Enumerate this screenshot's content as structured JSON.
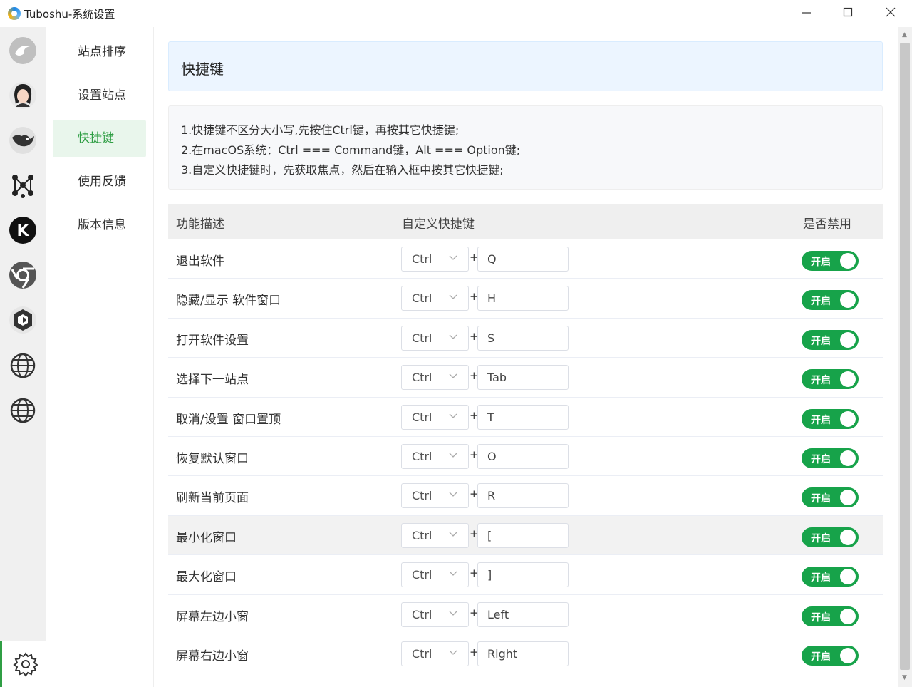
{
  "window": {
    "title": "Tuboshu-系统设置"
  },
  "colors": {
    "accent": "#17a34a",
    "active_menu_bg": "#e9f6ec",
    "header_bg": "#ecf5ff"
  },
  "site_icons": [
    "site-1-icon",
    "avatar-site-icon",
    "bird-site-icon",
    "network-site-icon",
    "k-site-icon",
    "chrome-site-icon",
    "cube-site-icon",
    "globe-site-icon",
    "globe-site-icon-2"
  ],
  "menu": {
    "items": [
      {
        "label": "站点排序"
      },
      {
        "label": "设置站点"
      },
      {
        "label": "快捷键"
      },
      {
        "label": "使用反馈"
      },
      {
        "label": "版本信息"
      }
    ],
    "active_index": 2
  },
  "page": {
    "title": "快捷键",
    "tips": [
      "1.快捷键不区分大小写,先按住Ctrl键，再按其它快捷键;",
      "2.在macOS系统：Ctrl === Command键，Alt === Option键;",
      "3.自定义快捷键时，先获取焦点，然后在输入框中按其它快捷键;"
    ]
  },
  "table": {
    "headers": {
      "desc": "功能描述",
      "shortcut": "自定义快捷键",
      "enabled": "是否禁用"
    },
    "plus": "+",
    "switch_label": "开启",
    "rows": [
      {
        "desc": "退出软件",
        "modifier": "Ctrl",
        "key": "Q",
        "enabled": true
      },
      {
        "desc": "隐藏/显示 软件窗口",
        "modifier": "Ctrl",
        "key": "H",
        "enabled": true
      },
      {
        "desc": "打开软件设置",
        "modifier": "Ctrl",
        "key": "S",
        "enabled": true
      },
      {
        "desc": "选择下一站点",
        "modifier": "Ctrl",
        "key": "Tab",
        "enabled": true
      },
      {
        "desc": "取消/设置 窗口置顶",
        "modifier": "Ctrl",
        "key": "T",
        "enabled": true
      },
      {
        "desc": "恢复默认窗口",
        "modifier": "Ctrl",
        "key": "O",
        "enabled": true
      },
      {
        "desc": "刷新当前页面",
        "modifier": "Ctrl",
        "key": "R",
        "enabled": true
      },
      {
        "desc": "最小化窗口",
        "modifier": "Ctrl",
        "key": "[",
        "enabled": true
      },
      {
        "desc": "最大化窗口",
        "modifier": "Ctrl",
        "key": "]",
        "enabled": true
      },
      {
        "desc": "屏幕左边小窗",
        "modifier": "Ctrl",
        "key": "Left",
        "enabled": true
      },
      {
        "desc": "屏幕右边小窗",
        "modifier": "Ctrl",
        "key": "Right",
        "enabled": true
      }
    ]
  }
}
